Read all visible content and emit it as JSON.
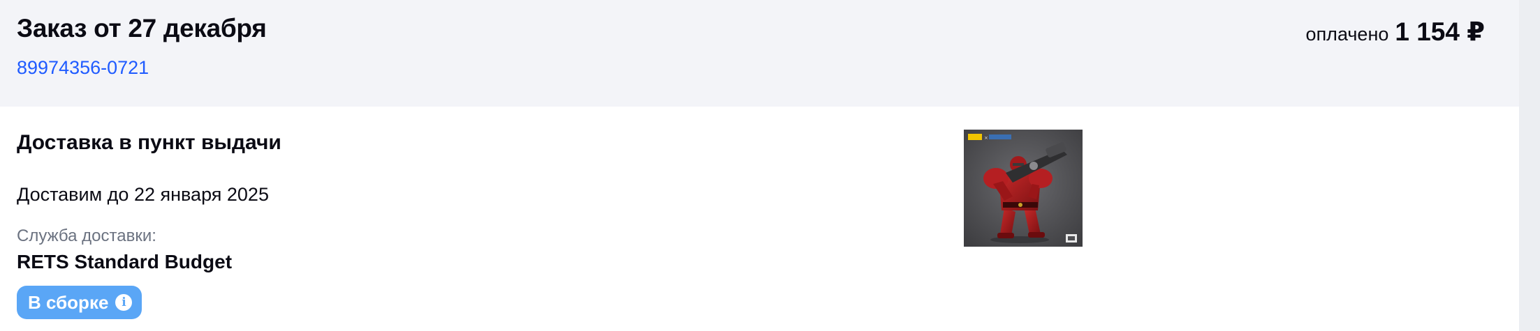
{
  "order": {
    "title": "Заказ от 27 декабря",
    "number": "89974356-0721",
    "payment_status": "оплачено",
    "payment_amount": "1 154 ₽"
  },
  "delivery": {
    "title": "Доставка в пункт выдачи",
    "date": "Доставим до 22 января 2025",
    "service_label": "Служба доставки:",
    "service_name": "RETS Standard Budget",
    "status": "В сборке",
    "status_icon": "info-icon"
  },
  "product": {
    "thumbnail_icon": "action-figure-thumbnail",
    "colors": {
      "background": "#4f4f52",
      "figure": "#a1191c"
    }
  },
  "colors": {
    "header_bg": "#f3f4f8",
    "link": "#1f5bff",
    "badge": "#5aa6f6",
    "muted_text": "#6b7280"
  }
}
